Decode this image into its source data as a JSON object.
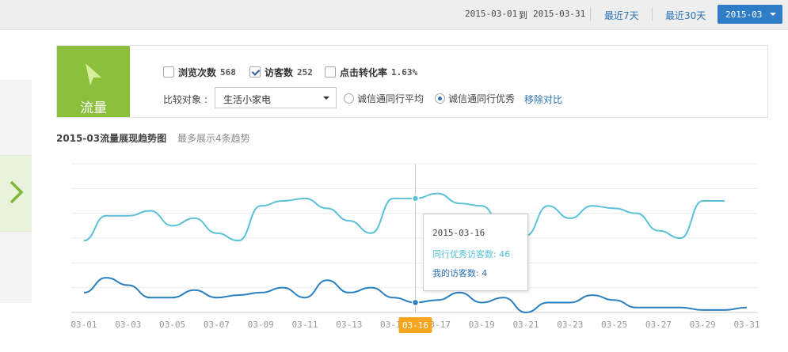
{
  "date_range": {
    "start": "2015-03-01",
    "connector": "到",
    "end": "2015-03-31"
  },
  "quick_ranges": [
    "最近7天",
    "最近30天"
  ],
  "month_selector": {
    "label": "2015-03"
  },
  "metric_panel": {
    "title": "流量",
    "metrics": [
      {
        "label": "浏览次数",
        "value": "568",
        "checked": false
      },
      {
        "label": "访客数",
        "value": "252",
        "checked": true
      },
      {
        "label": "点击转化率",
        "value": "1.63%",
        "checked": false
      }
    ],
    "compare_label": "比较对象 :",
    "compare_select": {
      "value": "生活小家电"
    },
    "compare_options": [
      {
        "label": "诚信通同行平均",
        "selected": false
      },
      {
        "label": "诚信通同行优秀",
        "selected": true
      }
    ],
    "remove_compare": "移除对比"
  },
  "chart": {
    "title": "2015-03流量展现趋势图",
    "subtitle": "最多展示4条趋势",
    "highlight_tick": "03-16"
  },
  "tooltip": {
    "date": "2015-03-16",
    "rows": [
      {
        "label": "同行优秀访客数:",
        "value": "46"
      },
      {
        "label": "我的访客数:",
        "value": "4"
      }
    ]
  },
  "colors": {
    "peer_series": "#5bc1d6",
    "my_series": "#2a7fc0",
    "highlight": "#f7a520",
    "brand_green": "#8cc03c",
    "link": "#2a72b5"
  },
  "chart_data": {
    "type": "line",
    "x": [
      "03-01",
      "03-02",
      "03-03",
      "03-04",
      "03-05",
      "03-06",
      "03-07",
      "03-08",
      "03-09",
      "03-10",
      "03-11",
      "03-12",
      "03-13",
      "03-14",
      "03-15",
      "03-16",
      "03-17",
      "03-18",
      "03-19",
      "03-20",
      "03-21",
      "03-22",
      "03-23",
      "03-24",
      "03-25",
      "03-26",
      "03-27",
      "03-28",
      "03-29",
      "03-30",
      "03-31"
    ],
    "x_tick_labels": [
      "03-01",
      "03-03",
      "03-05",
      "03-07",
      "03-09",
      "03-11",
      "03-13",
      "03-15",
      "03-17",
      "03-19",
      "03-21",
      "03-23",
      "03-25",
      "03-27",
      "03-29",
      "03-31"
    ],
    "series": [
      {
        "key": "peer",
        "values": [
          29,
          39,
          39,
          41,
          35,
          38,
          32,
          29,
          43,
          45,
          46,
          42,
          37,
          32,
          46,
          46,
          48,
          44,
          43,
          34,
          31,
          43,
          38,
          43,
          42,
          40,
          33,
          30,
          45,
          45
        ]
      },
      {
        "key": "mine",
        "values": [
          8,
          14,
          11,
          6,
          6,
          9,
          6,
          7,
          8,
          10,
          6,
          13,
          8,
          10,
          6,
          4,
          5,
          8,
          4,
          6,
          0,
          4,
          4,
          7,
          5,
          2,
          2,
          2,
          1,
          1,
          2
        ]
      }
    ],
    "ylim": [
      0,
      60
    ],
    "grid": true,
    "highlight_index": 15
  }
}
